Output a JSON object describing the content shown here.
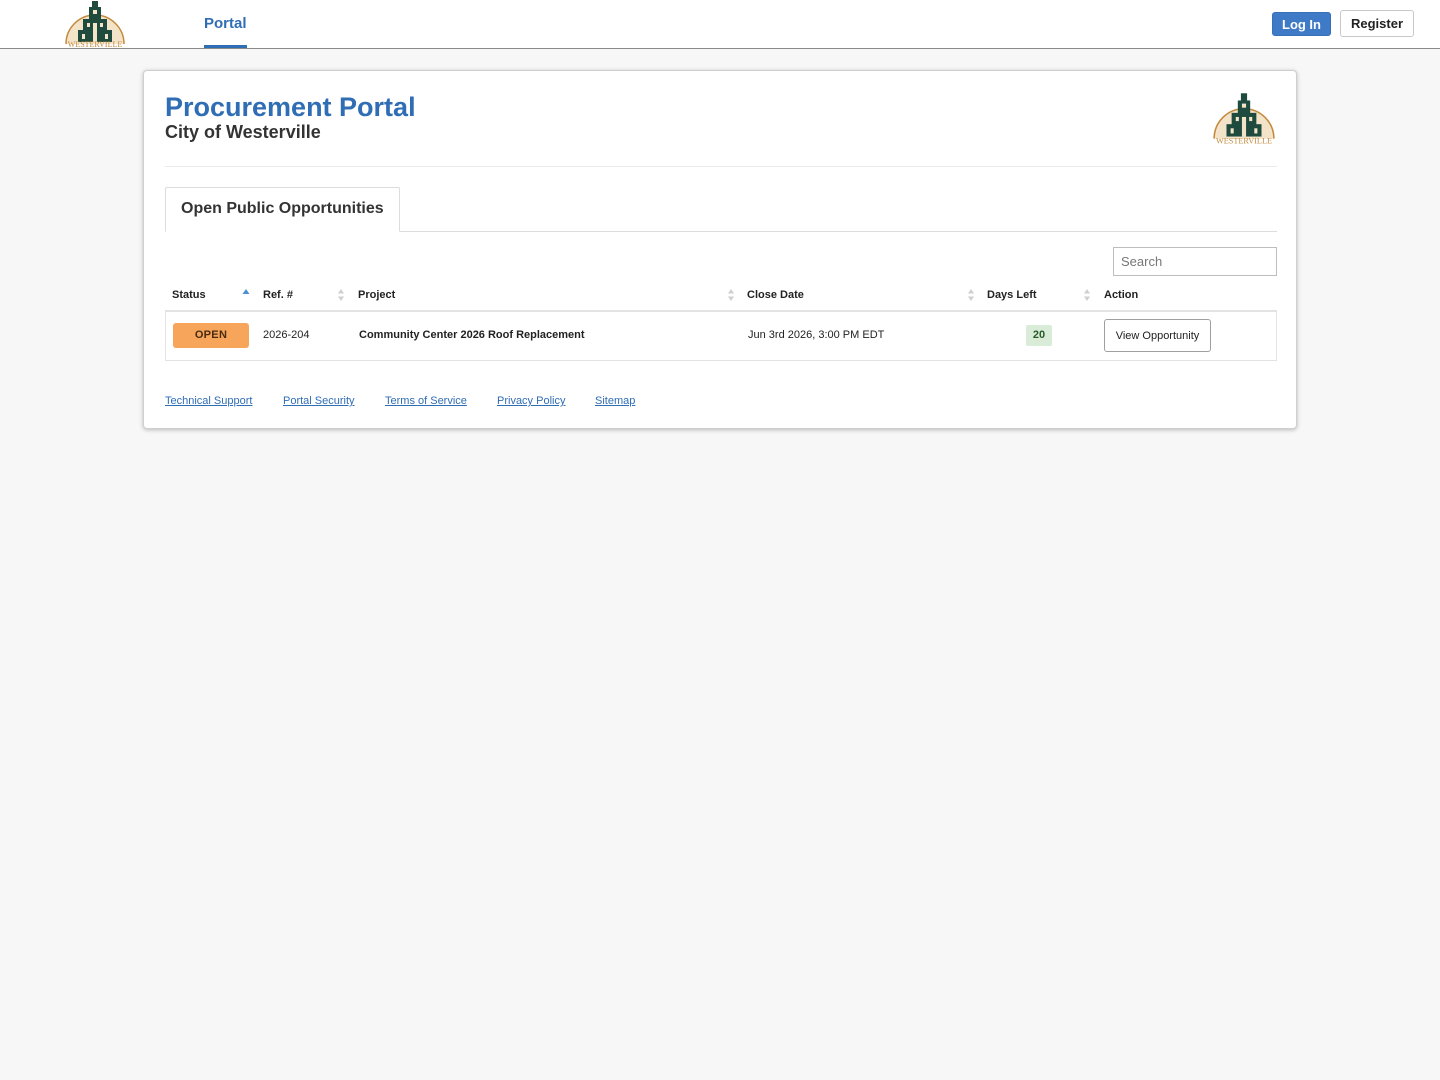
{
  "brand": {
    "name": "WESTERVILLE",
    "colors": {
      "primary": "#2f6db5",
      "logo_green": "#1f4b3f",
      "logo_gold": "#c48a3c",
      "status_open": "#f7a55a",
      "days_left_bg": "#d8ecd8"
    }
  },
  "nav": {
    "portal_label": "Portal",
    "login_label": "Log In",
    "register_label": "Register"
  },
  "header": {
    "title": "Procurement Portal",
    "subtitle": "City of Westerville"
  },
  "tabs": [
    {
      "label": "Open Public Opportunities",
      "active": true
    }
  ],
  "search": {
    "placeholder": "Search",
    "value": ""
  },
  "table": {
    "columns": [
      {
        "key": "status",
        "label": "Status",
        "sort": "ascending"
      },
      {
        "key": "ref",
        "label": "Ref. #",
        "sort": "none"
      },
      {
        "key": "project",
        "label": "Project",
        "sort": "none"
      },
      {
        "key": "close_date",
        "label": "Close Date",
        "sort": "none"
      },
      {
        "key": "days_left",
        "label": "Days Left",
        "sort": "none"
      },
      {
        "key": "action",
        "label": "Action"
      }
    ],
    "rows": [
      {
        "status": "OPEN",
        "ref": "2026-204",
        "project": "Community Center 2026 Roof Replacement",
        "close_date": "Jun 3rd 2026, 3:00 PM EDT",
        "days_left": "20",
        "action_label": "View Opportunity"
      }
    ]
  },
  "footer": {
    "links": [
      "Technical Support",
      "Portal Security",
      "Terms of Service",
      "Privacy Policy",
      "Sitemap"
    ]
  },
  "icons": {
    "logo": "city-hall-seal-icon",
    "sort_asc": "sort-ascending-icon",
    "sort_none": "sort-unsorted-icon"
  }
}
